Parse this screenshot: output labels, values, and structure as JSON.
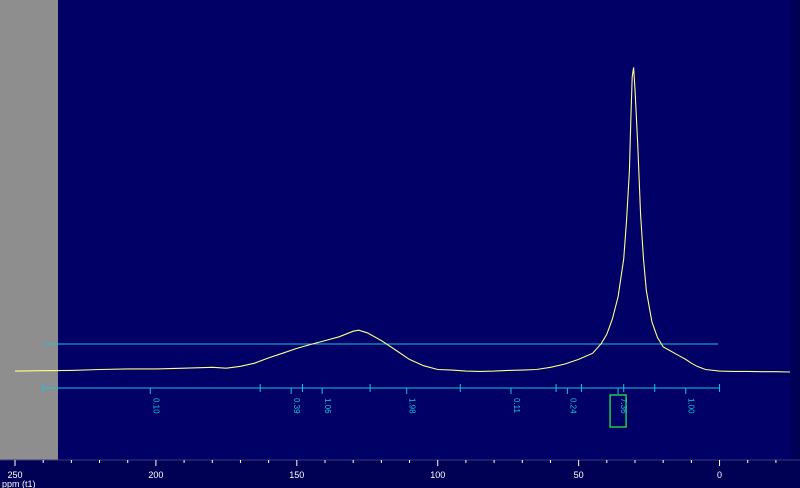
{
  "colors": {
    "background": "#000066",
    "spectrum": "#ffff88",
    "integral": "#19c3e0",
    "axis_text": "#ffffff",
    "selected_box": "#22cc44",
    "side_panel": "#8e8e8e"
  },
  "chart_data": {
    "type": "line",
    "xlabel": "ppm (t1)",
    "x_reversed": true,
    "xlim": [
      250,
      -25
    ],
    "ylim": [
      0,
      1
    ],
    "x_ticks": [
      "250",
      "200",
      "150",
      "100",
      "50",
      "0"
    ],
    "x_tick_values": [
      250,
      200,
      150,
      100,
      50,
      0
    ],
    "series": [
      {
        "x": [
          250,
          240,
          230,
          220,
          210,
          200,
          190,
          180,
          175,
          170,
          165,
          160,
          155,
          150,
          145,
          140,
          135,
          130,
          128,
          125,
          120,
          115,
          110,
          105,
          100,
          95,
          90,
          85,
          80,
          75,
          70,
          65,
          60,
          55,
          50,
          45,
          42,
          40,
          38,
          36,
          34,
          33,
          32,
          31.5,
          31,
          30.5,
          30,
          29,
          28,
          27,
          26,
          24,
          22,
          20,
          18,
          16,
          14,
          12,
          10,
          8,
          5,
          0,
          -5,
          -10,
          -15,
          -20,
          -25
        ],
        "y": [
          0.003,
          0.004,
          0.005,
          0.008,
          0.01,
          0.01,
          0.012,
          0.015,
          0.012,
          0.018,
          0.028,
          0.045,
          0.06,
          0.075,
          0.088,
          0.1,
          0.112,
          0.13,
          0.133,
          0.125,
          0.1,
          0.07,
          0.04,
          0.02,
          0.008,
          0.006,
          0.003,
          0.002,
          0.003,
          0.005,
          0.006,
          0.008,
          0.015,
          0.025,
          0.04,
          0.06,
          0.09,
          0.12,
          0.17,
          0.24,
          0.36,
          0.48,
          0.64,
          0.8,
          0.94,
          0.97,
          0.9,
          0.72,
          0.5,
          0.36,
          0.26,
          0.16,
          0.11,
          0.08,
          0.07,
          0.06,
          0.05,
          0.04,
          0.028,
          0.018,
          0.008,
          0.003,
          0.002,
          0.002,
          0.001,
          0.001,
          0.0
        ]
      }
    ],
    "integrals": [
      {
        "label": "0.10",
        "ppm": 202,
        "selected": false
      },
      {
        "label": "0.39",
        "ppm": 152,
        "selected": false
      },
      {
        "label": "1.06",
        "ppm": 141,
        "selected": false
      },
      {
        "label": "1.98",
        "ppm": 111,
        "selected": false
      },
      {
        "label": "0.11",
        "ppm": 74,
        "selected": false
      },
      {
        "label": "0.24",
        "ppm": 54,
        "selected": false
      },
      {
        "label": "7.36",
        "ppm": 36,
        "selected": true
      },
      {
        "label": "1.00",
        "ppm": 12,
        "selected": false
      }
    ],
    "integral_bar_range": [
      240,
      0
    ],
    "integral_bar_segments": [
      240,
      163,
      148,
      124,
      92,
      58,
      49,
      34,
      23,
      0
    ]
  }
}
